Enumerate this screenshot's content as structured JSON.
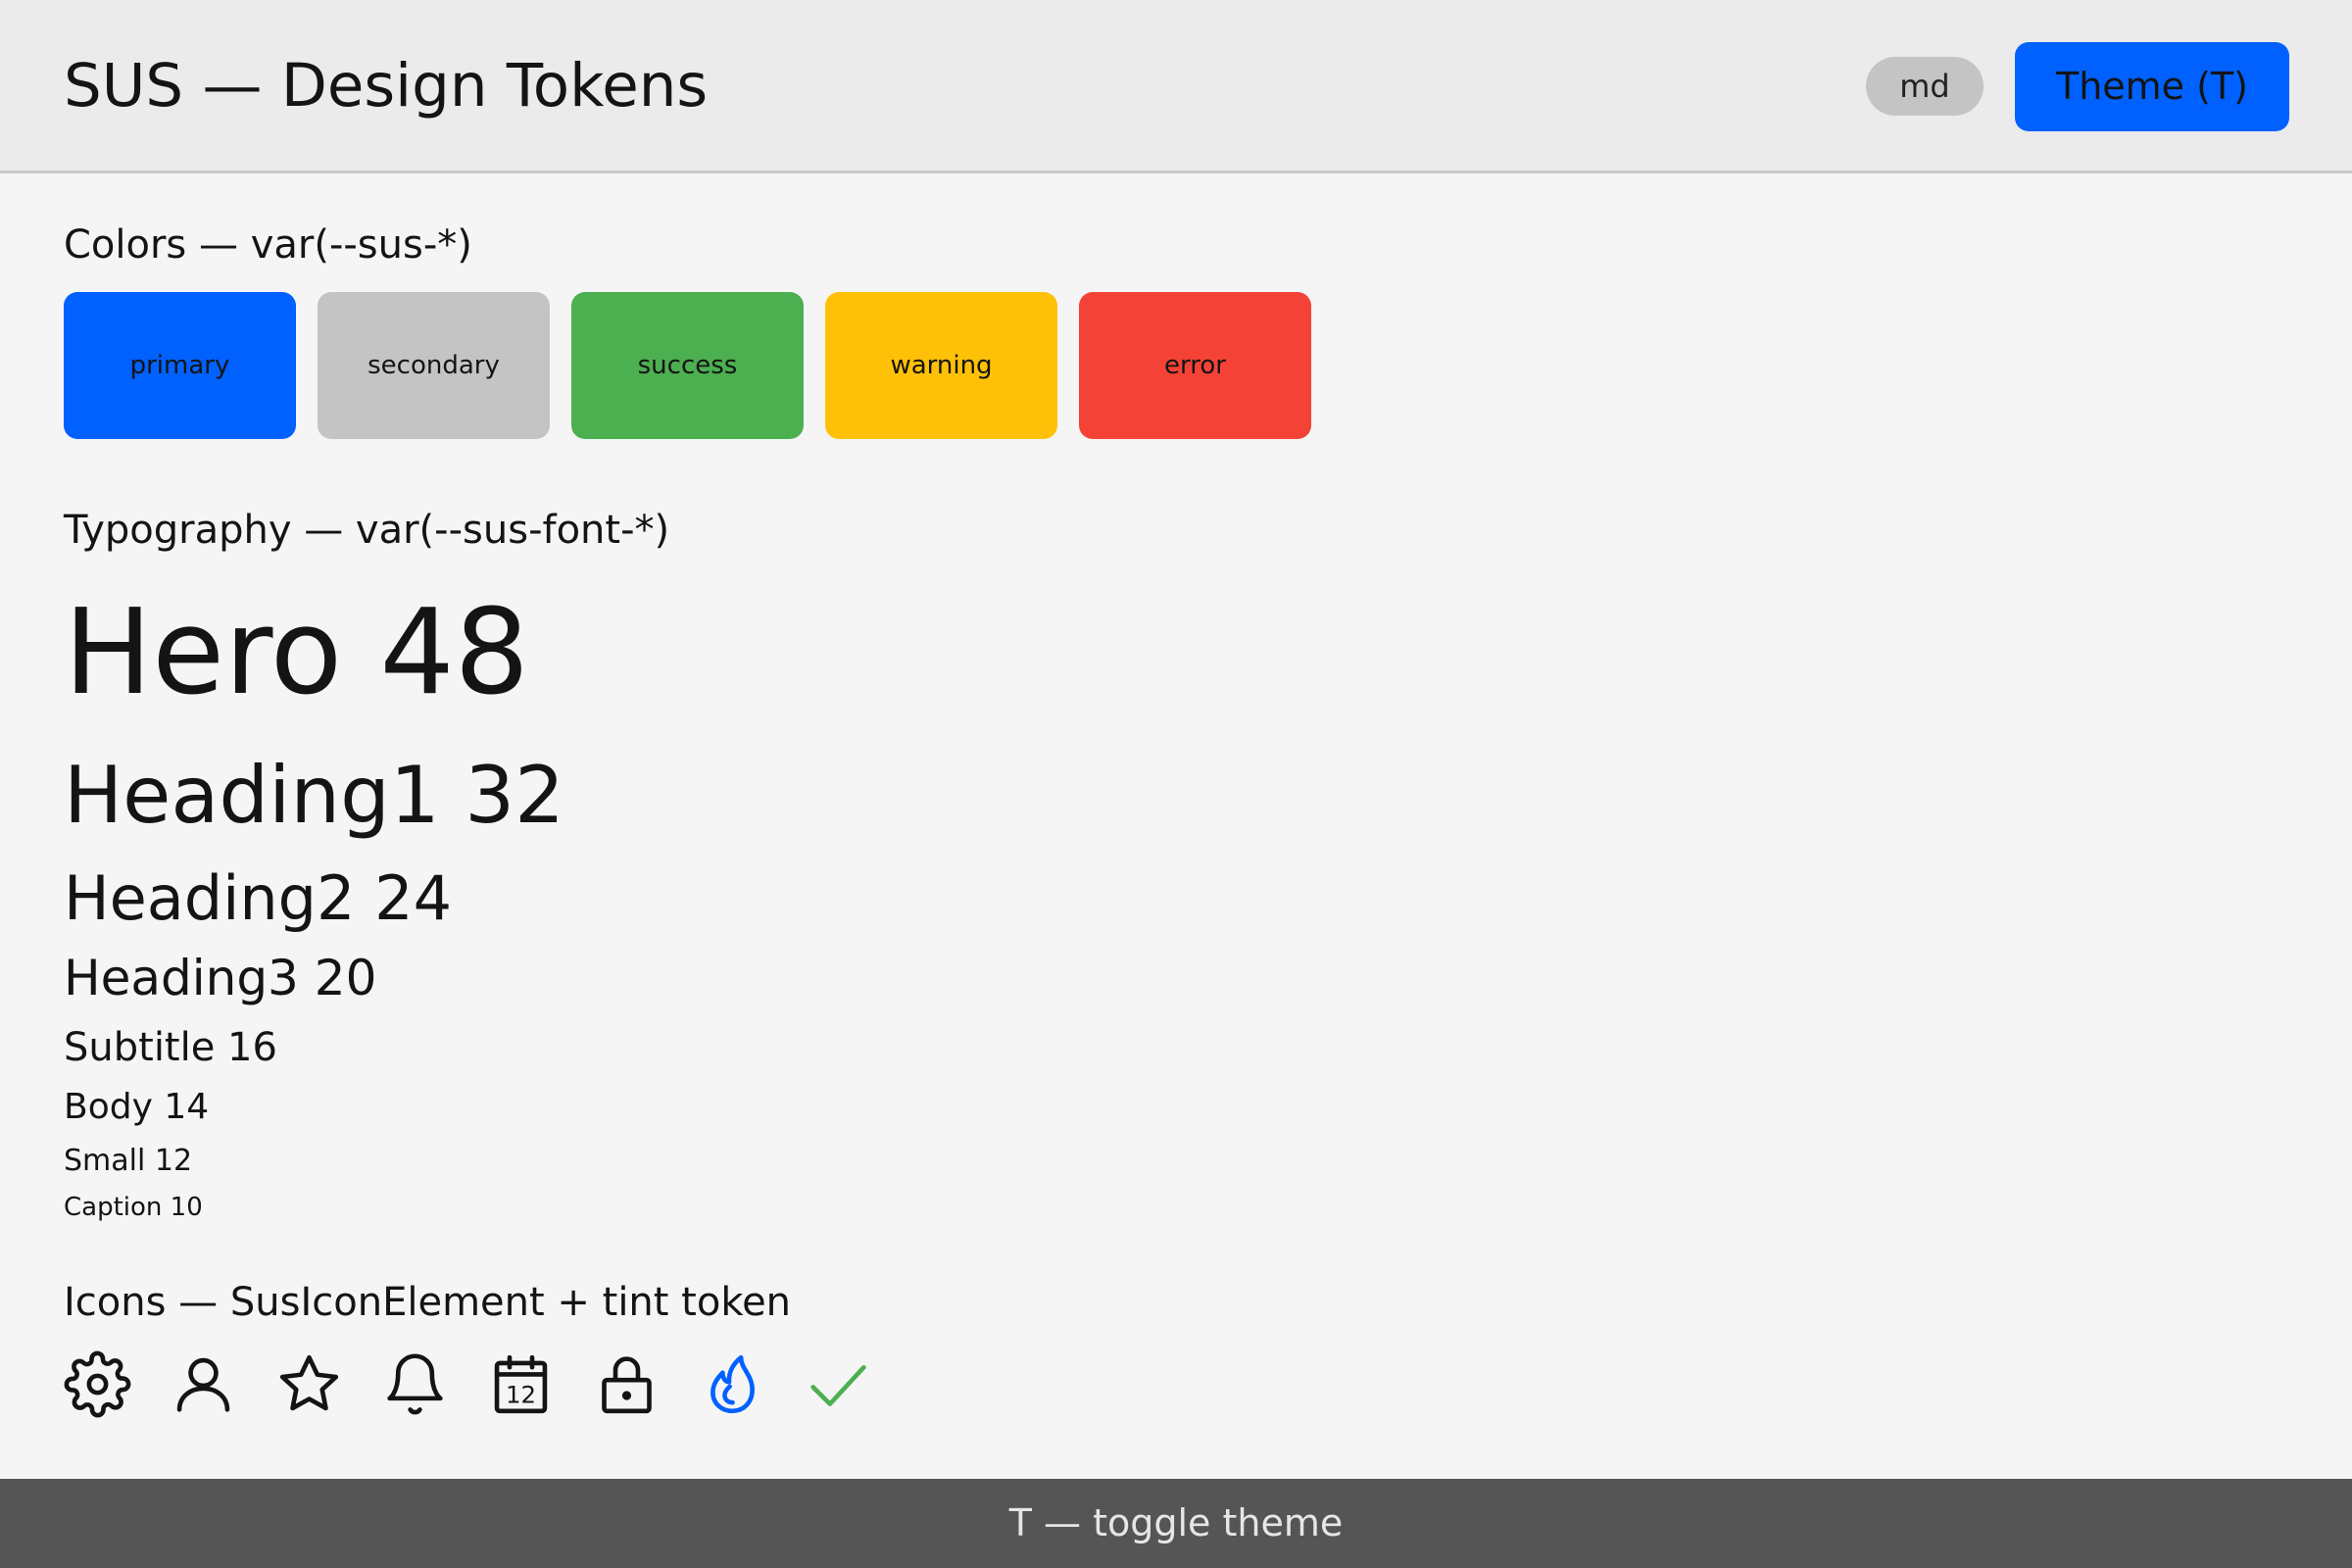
{
  "header": {
    "title": "SUS — Design Tokens",
    "size_badge": "md",
    "theme_button_label": "Theme (T)"
  },
  "colors_section": {
    "title": "Colors — var(--sus-*)",
    "swatches": [
      {
        "label": "primary",
        "color": "#0061ff"
      },
      {
        "label": "secondary",
        "color": "#c4c4c4"
      },
      {
        "label": "success",
        "color": "#4caf50"
      },
      {
        "label": "warning",
        "color": "#ffc107"
      },
      {
        "label": "error",
        "color": "#f44336"
      }
    ]
  },
  "typography_section": {
    "title": "Typography — var(--sus-font-*)",
    "samples": [
      {
        "label": "Hero 48"
      },
      {
        "label": "Heading1 32"
      },
      {
        "label": "Heading2 24"
      },
      {
        "label": "Heading3 20"
      },
      {
        "label": "Subtitle 16"
      },
      {
        "label": "Body 14"
      },
      {
        "label": "Small 12"
      },
      {
        "label": "Caption 10"
      }
    ]
  },
  "icons_section": {
    "title": "Icons — SusIconElement + tint token",
    "icons": [
      {
        "name": "gear-icon",
        "color": "#141414"
      },
      {
        "name": "user-icon",
        "color": "#141414"
      },
      {
        "name": "star-icon",
        "color": "#141414"
      },
      {
        "name": "bell-icon",
        "color": "#141414"
      },
      {
        "name": "calendar-icon",
        "color": "#141414",
        "text": "12"
      },
      {
        "name": "lock-icon",
        "color": "#141414"
      },
      {
        "name": "flame-icon",
        "color": "#0061ff"
      },
      {
        "name": "checkmark-icon",
        "color": "#4caf50"
      }
    ]
  },
  "footer": {
    "hint": "T — toggle theme"
  }
}
